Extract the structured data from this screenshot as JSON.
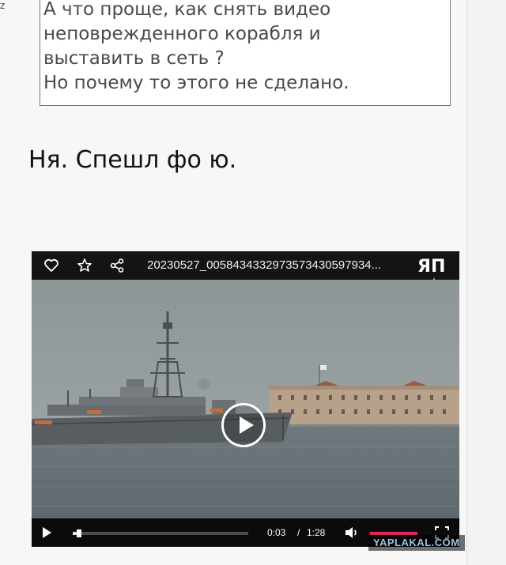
{
  "left_mark": "z",
  "quote": {
    "lines": [
      "А что проще, как снять видео",
      "неповрежденного корабля и",
      "выставить в сеть ?",
      "Но почему то этого не сделано."
    ]
  },
  "reply": {
    "text": "Ня. Спешл фо ю."
  },
  "player": {
    "title": "20230527_0058434332973573430597934...",
    "logo_text": "ЯП",
    "icons": [
      "heart-icon",
      "star-icon",
      "share-icon"
    ],
    "current_time": "0:03",
    "separator": "/",
    "duration": "1:28",
    "progress_fraction": 0.034,
    "volume_fraction": 1.0,
    "accent_color": "#e0245e"
  },
  "watermark": "YAPLAKAL.COM"
}
